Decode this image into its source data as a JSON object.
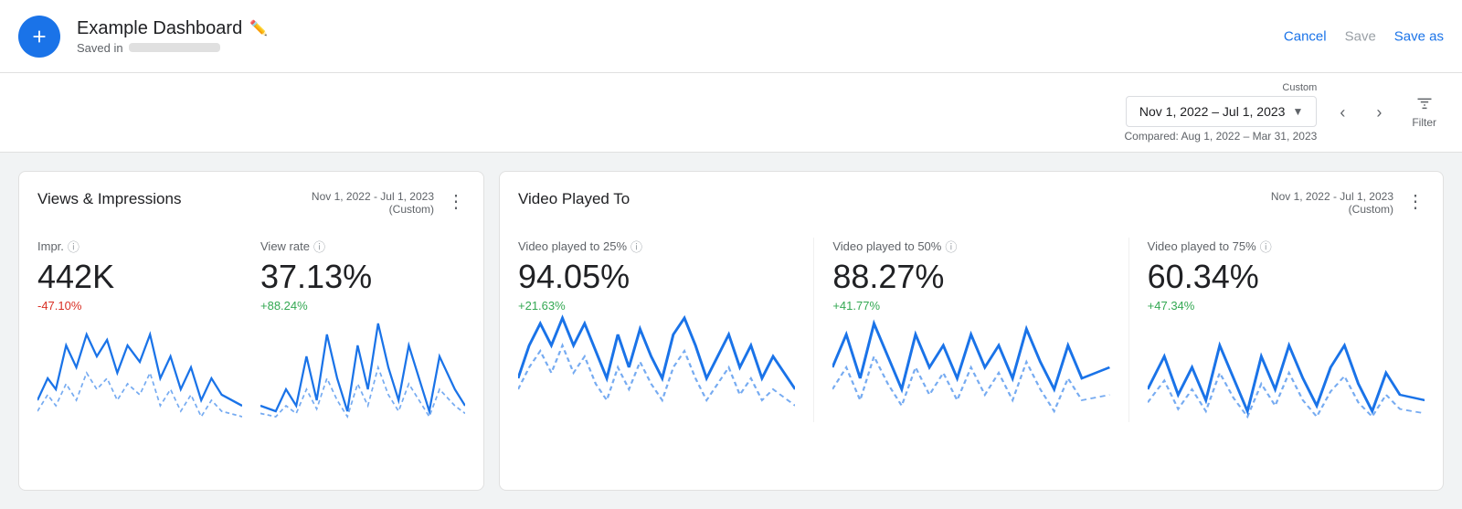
{
  "header": {
    "title": "Example Dashboard",
    "saved_text": "Saved in",
    "add_label": "+",
    "cancel_label": "Cancel",
    "save_label": "Save",
    "save_as_label": "Save as"
  },
  "filter_bar": {
    "custom_label": "Custom",
    "date_range": "Nov 1, 2022 – Jul 1, 2023",
    "compared_text": "Compared: Aug 1, 2022 – Mar 31, 2023",
    "filter_label": "Filter"
  },
  "cards": {
    "views_impressions": {
      "title": "Views & Impressions",
      "date_range": "Nov 1, 2022 - Jul 1, 2023",
      "date_sub": "(Custom)",
      "metrics": [
        {
          "label": "Impr.",
          "value": "442K",
          "change": "-47.10%",
          "positive": false
        },
        {
          "label": "View rate",
          "value": "37.13%",
          "change": "+88.24%",
          "positive": true
        }
      ]
    },
    "video_played": {
      "title": "Video Played To",
      "date_range": "Nov 1, 2022 - Jul 1, 2023",
      "date_sub": "(Custom)",
      "metrics": [
        {
          "label": "Video played to 25%",
          "value": "94.05%",
          "change": "+21.63%",
          "positive": true
        },
        {
          "label": "Video played to 50%",
          "value": "88.27%",
          "change": "+41.77%",
          "positive": true
        },
        {
          "label": "Video played to 75%",
          "value": "60.34%",
          "change": "+47.34%",
          "positive": true
        }
      ]
    }
  }
}
